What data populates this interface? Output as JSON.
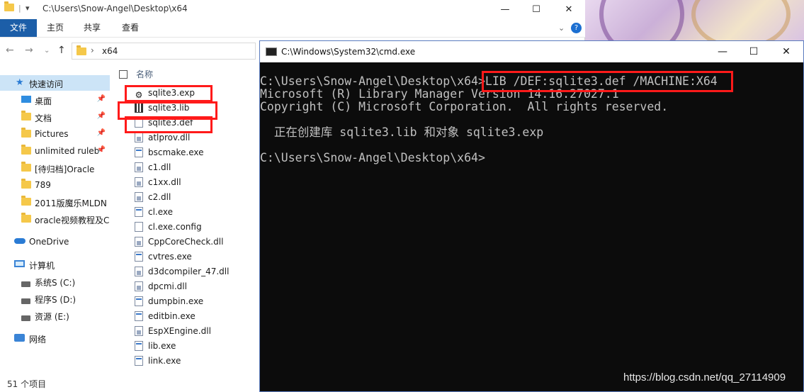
{
  "explorer": {
    "title_path": "C:\\Users\\Snow-Angel\\Desktop\\x64",
    "window_buttons": [
      "—",
      "☐",
      "✕"
    ],
    "ribbon_tabs": [
      "文件",
      "主页",
      "共享",
      "查看"
    ],
    "address_segment": "x64",
    "column_header": "名称",
    "nav_items": [
      {
        "label": "快速访问",
        "icon": "star-icon"
      },
      {
        "label": "桌面",
        "icon": "desktop-icon",
        "pinned": true
      },
      {
        "label": "文档",
        "icon": "folder-icon",
        "pinned": true
      },
      {
        "label": "Pictures",
        "icon": "folder-icon",
        "pinned": true
      },
      {
        "label": "unlimited ruleb",
        "icon": "folder-icon",
        "pinned": true
      },
      {
        "label": "[待归档]Oracle",
        "icon": "folder-icon"
      },
      {
        "label": "789",
        "icon": "folder-icon"
      },
      {
        "label": "2011版魔乐MLDN",
        "icon": "folder-icon"
      },
      {
        "label": "oracle视频教程及C",
        "icon": "folder-icon"
      },
      {
        "label": "OneDrive",
        "icon": "cloud-icon"
      },
      {
        "label": "计算机",
        "icon": "computer-icon"
      },
      {
        "label": "系统S (C:)",
        "icon": "drive-icon"
      },
      {
        "label": "程序S (D:)",
        "icon": "drive-icon"
      },
      {
        "label": "资源 (E:)",
        "icon": "drive-icon"
      },
      {
        "label": "网络",
        "icon": "network-icon"
      }
    ],
    "files": [
      {
        "name": "sqlite3.exp",
        "type": "exp"
      },
      {
        "name": "sqlite3.lib",
        "type": "lib"
      },
      {
        "name": "sqlite3.def",
        "type": "def"
      },
      {
        "name": "atlprov.dll",
        "type": "dll"
      },
      {
        "name": "bscmake.exe",
        "type": "exe"
      },
      {
        "name": "c1.dll",
        "type": "dll"
      },
      {
        "name": "c1xx.dll",
        "type": "dll"
      },
      {
        "name": "c2.dll",
        "type": "dll"
      },
      {
        "name": "cl.exe",
        "type": "exe"
      },
      {
        "name": "cl.exe.config",
        "type": "config"
      },
      {
        "name": "CppCoreCheck.dll",
        "type": "dll"
      },
      {
        "name": "cvtres.exe",
        "type": "exe"
      },
      {
        "name": "d3dcompiler_47.dll",
        "type": "dll"
      },
      {
        "name": "dpcmi.dll",
        "type": "dll"
      },
      {
        "name": "dumpbin.exe",
        "type": "exe"
      },
      {
        "name": "editbin.exe",
        "type": "exe"
      },
      {
        "name": "EspXEngine.dll",
        "type": "dll"
      },
      {
        "name": "lib.exe",
        "type": "exe"
      },
      {
        "name": "link.exe",
        "type": "exe"
      }
    ],
    "status_text": "51 个项目"
  },
  "cmd": {
    "title": "C:\\Windows\\System32\\cmd.exe",
    "window_buttons": [
      "—",
      "☐",
      "✕"
    ],
    "lines": [
      "C:\\Users\\Snow-Angel\\Desktop\\x64>LIB /DEF:sqlite3.def /MACHINE:X64",
      "Microsoft (R) Library Manager Version 14.16.27027.1",
      "Copyright (C) Microsoft Corporation.  All rights reserved.",
      "",
      "  正在创建库 sqlite3.lib 和对象 sqlite3.exp",
      "",
      "C:\\Users\\Snow-Angel\\Desktop\\x64>"
    ]
  },
  "watermark": "https://blog.csdn.net/qq_27114909"
}
